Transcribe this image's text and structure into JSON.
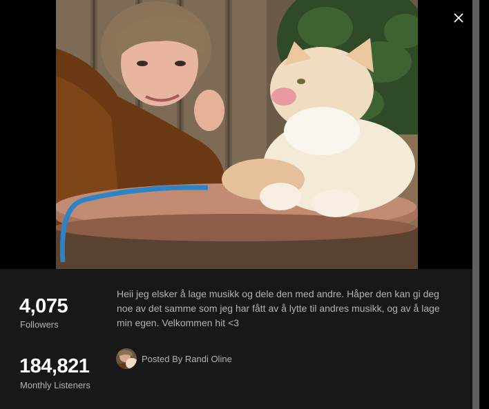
{
  "modal": {
    "close_icon": "close-icon",
    "photo_alt": "Profile photo of woman with cat"
  },
  "stats": {
    "followers_value": "4,075",
    "followers_label": "Followers",
    "listeners_value": "184,821",
    "listeners_label": "Monthly Listeners"
  },
  "bio": "Heii jeg elsker å lage musikk og dele den med andre. Håper den kan gi deg noe av det samme som jeg har fått av å lytte til andres musikk, og av å lage min egen. Velkommen hit <3",
  "poster": {
    "label": "Posted By Randi Oline"
  },
  "colors": {
    "background": "#121212",
    "info_panel": "#181818",
    "text_primary": "#ffffff",
    "text_secondary": "#b3b3b3"
  }
}
